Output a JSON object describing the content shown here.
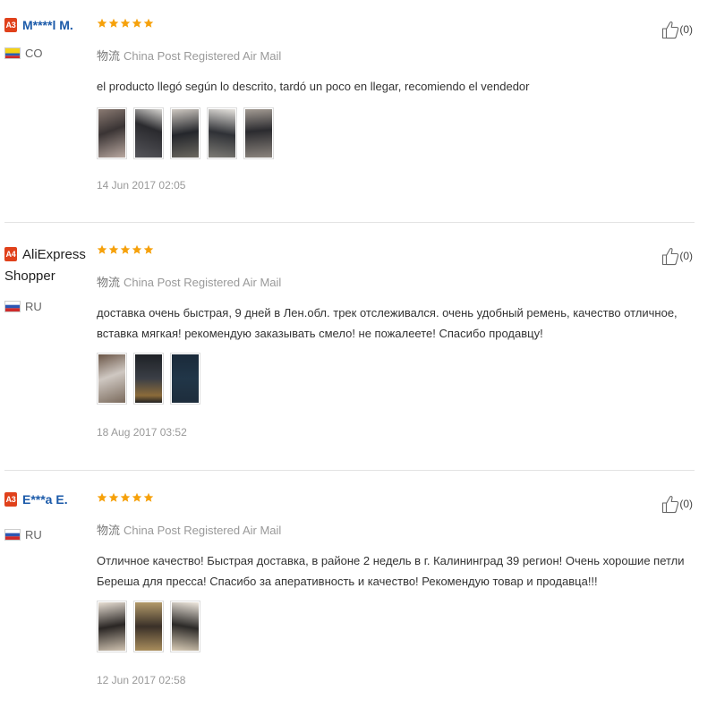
{
  "reviews": [
    {
      "level": "A3",
      "name": "M****l M.",
      "country": "CO",
      "flag_colors": [
        "#f5d216",
        "#2c5fb3",
        "#cf2a2a"
      ],
      "rating": 5,
      "logistics_label": "物流",
      "logistics": "China Post Registered Air Mail",
      "text": "el producto llegó según lo descrito, tardó un poco en llegar, recomiendo el vendedor",
      "photos": 5,
      "date": "14 Jun 2017 02:05",
      "helpful": "(0)"
    },
    {
      "level": "A4",
      "name": "AliExpress Shopper",
      "country": "RU",
      "flag_colors": [
        "#ffffff",
        "#2c56b3",
        "#cf2a2a"
      ],
      "rating": 5,
      "logistics_label": "物流",
      "logistics": "China Post Registered Air Mail",
      "text": "доставка очень быстрая, 9 дней в Лен.обл. трек отслеживался. очень удобный ремень, качество отличное, вставка мягкая! рекомендую заказывать смело! не пожалеете! Спасибо продавцу!",
      "photos": 3,
      "date": "18 Aug 2017 03:52",
      "helpful": "(0)"
    },
    {
      "level": "A3",
      "name": "E***a E.",
      "country": "RU",
      "flag_colors": [
        "#ffffff",
        "#2c56b3",
        "#cf2a2a"
      ],
      "rating": 5,
      "logistics_label": "物流",
      "logistics": "China Post Registered Air Mail",
      "text": "Отличное качество! Быстрая доставка, в районе 2 недель в г. Калининград 39 регион! Очень хорошие петли Береша для пресса! Спасибо за аперативность и качество! Рекомендую товар и продавца!!!",
      "photos": 3,
      "date": "12 Jun 2017 02:58",
      "helpful": "(0)"
    }
  ],
  "colors": {
    "star": "#f6a10b",
    "level_badge": "#e0411b",
    "name_link": "#1b5aa9",
    "muted": "#999999"
  }
}
